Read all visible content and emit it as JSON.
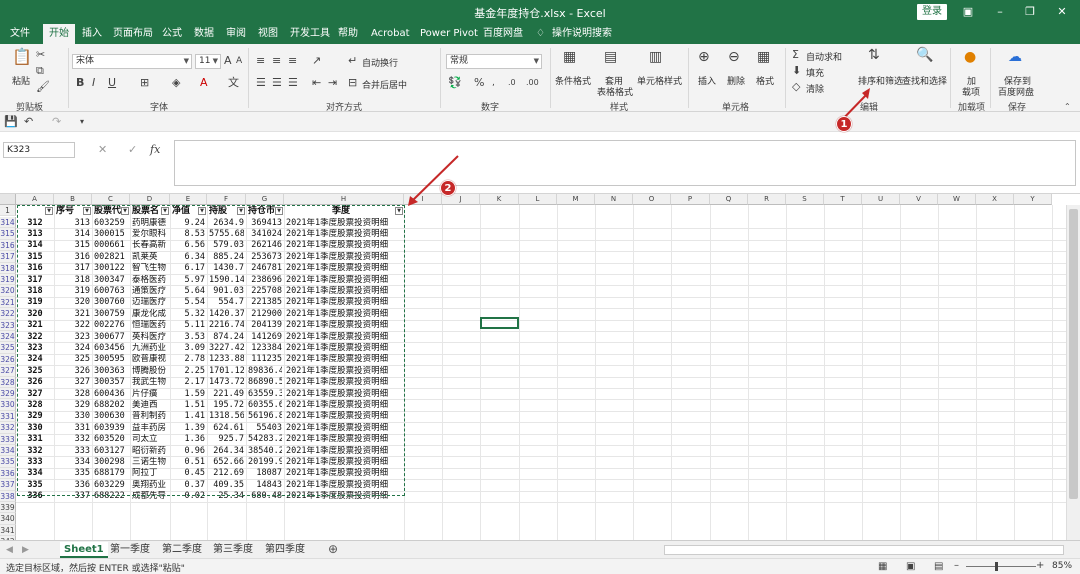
{
  "window": {
    "title": "基金年度持仓.xlsx - Excel",
    "login": "登录"
  },
  "menu": [
    "文件",
    "开始",
    "插入",
    "页面布局",
    "公式",
    "数据",
    "审阅",
    "视图",
    "开发工具",
    "帮助",
    "Acrobat",
    "Power Pivot",
    "百度网盘",
    "操作说明搜索"
  ],
  "ribbon": {
    "clipboard": {
      "paste": "粘贴",
      "label": "剪贴板"
    },
    "font": {
      "name": "宋体",
      "size": "11",
      "label": "字体"
    },
    "align": {
      "wrap": "自动换行",
      "merge": "合并后居中",
      "label": "对齐方式"
    },
    "number": {
      "format": "常规",
      "label": "数字"
    },
    "styles": {
      "cond": "条件格式",
      "table_1": "套用",
      "table_2": "表格格式",
      "cell": "单元格样式",
      "label": "样式"
    },
    "cells": {
      "insert": "插入",
      "delete": "删除",
      "format": "格式",
      "label": "单元格"
    },
    "editing": {
      "autosum": "自动求和",
      "fill": "填充",
      "clear": "清除",
      "sort": "排序和筛选",
      "find": "查找和选择",
      "label": "编辑"
    },
    "addins": {
      "add_1": "加",
      "add_2": "载项",
      "label": "加载项"
    },
    "save": {
      "save_1": "保存到",
      "save_2": "百度网盘",
      "label": "保存"
    }
  },
  "formula": {
    "namebox": "K323",
    "fx": "fx"
  },
  "columns": [
    "A",
    "B",
    "C",
    "D",
    "E",
    "F",
    "G",
    "H",
    "I",
    "J",
    "K",
    "L",
    "M",
    "N",
    "O",
    "P",
    "Q",
    "R",
    "S",
    "T",
    "U",
    "V",
    "W",
    "X",
    "Y"
  ],
  "headers": [
    "序号",
    "股票代",
    "股票名",
    "净值",
    "持股",
    "持仓市",
    "季度"
  ],
  "rows": [
    {
      "r": "314",
      "a": "312",
      "b": "313",
      "c": "603259",
      "d": "药明康德",
      "e": "9.24",
      "f": "2634.9",
      "g": "369413",
      "h": "2021年1季度股票投资明细"
    },
    {
      "r": "315",
      "a": "313",
      "b": "314",
      "c": "300015",
      "d": "爱尔眼科",
      "e": "8.53",
      "f": "5755.68",
      "g": "341024",
      "h": "2021年1季度股票投资明细"
    },
    {
      "r": "316",
      "a": "314",
      "b": "315",
      "c": "000661",
      "d": "长春高新",
      "e": "6.56",
      "f": "579.03",
      "g": "262146",
      "h": "2021年1季度股票投资明细"
    },
    {
      "r": "317",
      "a": "315",
      "b": "316",
      "c": "002821",
      "d": "凯莱英",
      "e": "6.34",
      "f": "885.24",
      "g": "253673",
      "h": "2021年1季度股票投资明细"
    },
    {
      "r": "318",
      "a": "316",
      "b": "317",
      "c": "300122",
      "d": "智飞生物",
      "e": "6.17",
      "f": "1430.7",
      "g": "246781",
      "h": "2021年1季度股票投资明细"
    },
    {
      "r": "319",
      "a": "317",
      "b": "318",
      "c": "300347",
      "d": "泰格医药",
      "e": "5.97",
      "f": "1590.14",
      "g": "238696",
      "h": "2021年1季度股票投资明细"
    },
    {
      "r": "320",
      "a": "318",
      "b": "319",
      "c": "600763",
      "d": "通策医疗",
      "e": "5.64",
      "f": "901.03",
      "g": "225708",
      "h": "2021年1季度股票投资明细"
    },
    {
      "r": "321",
      "a": "319",
      "b": "320",
      "c": "300760",
      "d": "迈瑞医疗",
      "e": "5.54",
      "f": "554.7",
      "g": "221385",
      "h": "2021年1季度股票投资明细"
    },
    {
      "r": "322",
      "a": "320",
      "b": "321",
      "c": "300759",
      "d": "康龙化成",
      "e": "5.32",
      "f": "1420.37",
      "g": "212900",
      "h": "2021年1季度股票投资明细"
    },
    {
      "r": "323",
      "a": "321",
      "b": "322",
      "c": "002276",
      "d": "恒瑞医药",
      "e": "5.11",
      "f": "2216.74",
      "g": "204139",
      "h": "2021年1季度股票投资明细"
    },
    {
      "r": "324",
      "a": "322",
      "b": "323",
      "c": "300677",
      "d": "英科医疗",
      "e": "3.53",
      "f": "874.24",
      "g": "141269",
      "h": "2021年1季度股票投资明细"
    },
    {
      "r": "325",
      "a": "323",
      "b": "324",
      "c": "603456",
      "d": "九洲药业",
      "e": "3.09",
      "f": "3227.42",
      "g": "123384",
      "h": "2021年1季度股票投资明细"
    },
    {
      "r": "326",
      "a": "324",
      "b": "325",
      "c": "300595",
      "d": "欧普康视",
      "e": "2.78",
      "f": "1233.88",
      "g": "111235",
      "h": "2021年1季度股票投资明细"
    },
    {
      "r": "327",
      "a": "325",
      "b": "326",
      "c": "300363",
      "d": "博腾股份",
      "e": "2.25",
      "f": "1701.12",
      "g": "89836.4",
      "h": "2021年1季度股票投资明细"
    },
    {
      "r": "328",
      "a": "326",
      "b": "327",
      "c": "300357",
      "d": "我武生物",
      "e": "2.17",
      "f": "1473.72",
      "g": "86890.5",
      "h": "2021年1季度股票投资明细"
    },
    {
      "r": "329",
      "a": "327",
      "b": "328",
      "c": "600436",
      "d": "片仔癀",
      "e": "1.59",
      "f": "221.49",
      "g": "63559.3",
      "h": "2021年1季度股票投资明细"
    },
    {
      "r": "330",
      "a": "328",
      "b": "329",
      "c": "688202",
      "d": "美迪西",
      "e": "1.51",
      "f": "195.72",
      "g": "60355.6",
      "h": "2021年1季度股票投资明细"
    },
    {
      "r": "331",
      "a": "329",
      "b": "330",
      "c": "300630",
      "d": "普利制药",
      "e": "1.41",
      "f": "1318.56",
      "g": "56196.8",
      "h": "2021年1季度股票投资明细"
    },
    {
      "r": "332",
      "a": "330",
      "b": "331",
      "c": "603939",
      "d": "益丰药房",
      "e": "1.39",
      "f": "624.61",
      "g": "55403",
      "h": "2021年1季度股票投资明细"
    },
    {
      "r": "333",
      "a": "331",
      "b": "332",
      "c": "603520",
      "d": "司太立",
      "e": "1.36",
      "f": "925.7",
      "g": "54283.2",
      "h": "2021年1季度股票投资明细"
    },
    {
      "r": "334",
      "a": "332",
      "b": "333",
      "c": "603127",
      "d": "昭衍新药",
      "e": "0.96",
      "f": "264.34",
      "g": "38540.2",
      "h": "2021年1季度股票投资明细"
    },
    {
      "r": "335",
      "a": "333",
      "b": "334",
      "c": "300298",
      "d": "三诺生物",
      "e": "0.51",
      "f": "652.66",
      "g": "20199.9",
      "h": "2021年1季度股票投资明细"
    },
    {
      "r": "336",
      "a": "334",
      "b": "335",
      "c": "688179",
      "d": "阿拉丁",
      "e": "0.45",
      "f": "212.69",
      "g": "18087",
      "h": "2021年1季度股票投资明细"
    },
    {
      "r": "337",
      "a": "335",
      "b": "336",
      "c": "603229",
      "d": "奥翔药业",
      "e": "0.37",
      "f": "409.35",
      "g": "14843",
      "h": "2021年1季度股票投资明细"
    },
    {
      "r": "338",
      "a": "336",
      "b": "337",
      "c": "688222",
      "d": "成都先导",
      "e": "0.02",
      "f": "25.34",
      "g": "680.48",
      "h": "2021年1季度股票投资明细"
    }
  ],
  "empty_rows": [
    "339",
    "340",
    "341",
    "342"
  ],
  "tabs": [
    "Sheet1",
    "第一季度",
    "第二季度",
    "第三季度",
    "第四季度"
  ],
  "status": {
    "message": "选定目标区域，然后按 ENTER 或选择\"粘贴\"",
    "zoom": "85%"
  },
  "callouts": [
    "1",
    "2"
  ],
  "colors": {
    "brand": "#217346",
    "callout": "#c62828"
  }
}
